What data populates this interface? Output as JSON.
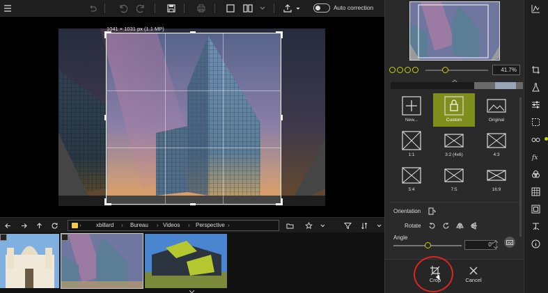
{
  "toolbar": {
    "auto_correction_label": "Auto correction",
    "icons": [
      "menu-icon",
      "undo-all-icon",
      "undo-icon",
      "redo-icon",
      "save-icon",
      "print-icon",
      "single-view-icon",
      "compare-view-icon",
      "share-icon"
    ]
  },
  "canvas": {
    "crop_dimensions": "1041 × 1031 px (1.1 MP)"
  },
  "browser": {
    "path": [
      "xbillard",
      "Bureau",
      "Videos",
      "Perspective"
    ]
  },
  "panel": {
    "zoom_value": "41.7%",
    "ratios": [
      {
        "label": "New...",
        "icon": "plus-icon"
      },
      {
        "label": "Custom",
        "icon": "lock-icon",
        "active": true
      },
      {
        "label": "Original",
        "icon": "image-icon"
      },
      {
        "label": "1:1"
      },
      {
        "label": "3:2 (4x6)"
      },
      {
        "label": "4:3"
      },
      {
        "label": "5:4"
      },
      {
        "label": "7:5"
      },
      {
        "label": "16:9"
      }
    ],
    "orientation_label": "Orientation",
    "rotate_label": "Rotate",
    "angle_label": "Angle",
    "angle_value": "0°",
    "crop_label": "Crop",
    "cancel_label": "Cancel"
  },
  "colors": {
    "accent": "#c9d400",
    "active_ratio": "#7f8f1d",
    "annotation": "#e02424"
  }
}
